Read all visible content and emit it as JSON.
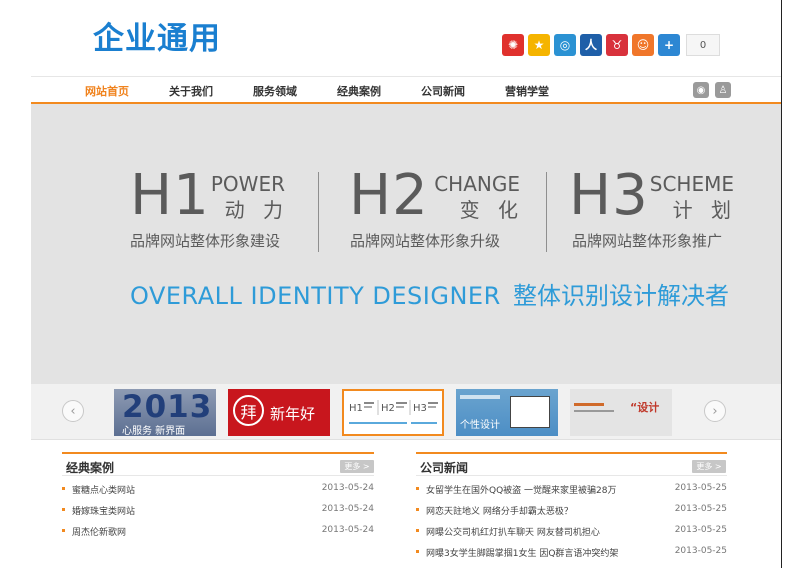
{
  "header": {
    "logo": "企业通用",
    "share_count": "0"
  },
  "share_icons": [
    {
      "icon": "weibo-icon",
      "color": "#e0312d",
      "glyph": "✺"
    },
    {
      "icon": "qzone-icon",
      "color": "#f5b400",
      "glyph": "★"
    },
    {
      "icon": "tencent-weibo-icon",
      "color": "#2b92d3",
      "glyph": "◎"
    },
    {
      "icon": "renren-icon",
      "color": "#1f5fa8",
      "glyph": "人"
    },
    {
      "icon": "kaixin-icon",
      "color": "#d8323c",
      "glyph": "♉"
    },
    {
      "icon": "pengyou-icon",
      "color": "#f0762a",
      "glyph": "☺"
    },
    {
      "icon": "more-share-icon",
      "color": "#2d87d3",
      "glyph": "+"
    }
  ],
  "nav": {
    "items": [
      "网站首页",
      "关于我们",
      "服务领域",
      "经典案例",
      "公司新闻",
      "营销学堂"
    ],
    "active_index": 0,
    "icons": [
      "weibo-icon",
      "qq-icon"
    ]
  },
  "banner": {
    "columns": [
      {
        "h": "H1",
        "en": "POWER",
        "cn": "动 力",
        "sub": "品牌网站整体形象建设"
      },
      {
        "h": "H2",
        "en": "CHANGE",
        "cn": "变 化",
        "sub": "品牌网站整体形象升级"
      },
      {
        "h": "H3",
        "en": "SCHEME",
        "cn": "计 划",
        "sub": "品牌网站整体形象推广"
      }
    ],
    "tagline_en": "OVERALL  IDENTITY  DESIGNER",
    "tagline_cn": "整体识别设计解决者"
  },
  "thumbs": {
    "t1_big": "2013",
    "t1_small": "心服务  新界面",
    "t2_seal": "拜",
    "t2_text": "新年好",
    "t4_label": "个性设计",
    "t5_label": "“设计",
    "prev_glyph": "‹",
    "next_glyph": "›"
  },
  "sections": {
    "cases": {
      "title": "经典案例",
      "more": "更多 >",
      "rows": [
        {
          "text": "蜜糖点心类网站",
          "date": "2013-05-24"
        },
        {
          "text": "婚嫁珠宝类网站",
          "date": "2013-05-24"
        },
        {
          "text": "周杰伦新歌网",
          "date": "2013-05-24"
        }
      ]
    },
    "news": {
      "title": "公司新闻",
      "more": "更多 >",
      "rows": [
        {
          "text": "女留学生在国外QQ被盗 一觉醒来家里被骗28万",
          "date": "2013-05-25"
        },
        {
          "text": "网恋天註地义 网络分手却霸太恶极？",
          "date": "2013-05-25"
        },
        {
          "text": "网曝公交司机红灯扒车聊天 网友替司机担心",
          "date": "2013-05-25"
        },
        {
          "text": "网曝3女学生脚踢掌掴1女生 因Q群言语冲突约架",
          "date": "2013-05-25"
        }
      ]
    }
  }
}
